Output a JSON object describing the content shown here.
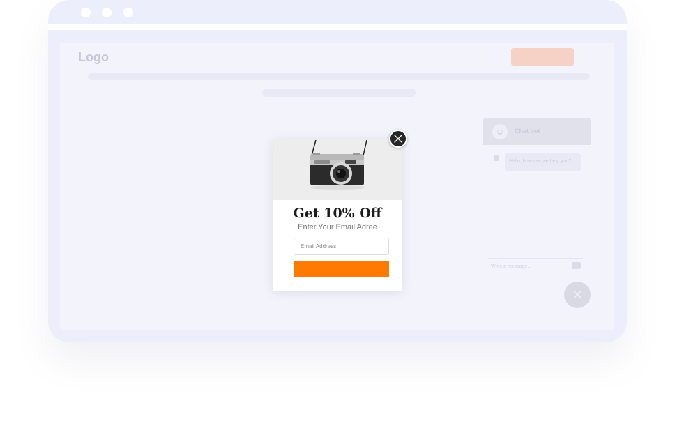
{
  "window": {
    "controls": [
      "dot",
      "dot",
      "dot"
    ]
  },
  "site": {
    "logo": "Logo",
    "chat": {
      "title": "Chat bot",
      "message": "Hello, how can we help you?",
      "input_placeholder": "Write a message..."
    }
  },
  "popup": {
    "title": "Get 10% Off",
    "subtitle": "Enter Your Email Adree",
    "email_placeholder": "Email Address",
    "submit_label": "",
    "accent_color": "#ff7a00"
  },
  "icons": {
    "close": "close-icon",
    "chat_fab": "close-icon",
    "image": "camera-image"
  }
}
